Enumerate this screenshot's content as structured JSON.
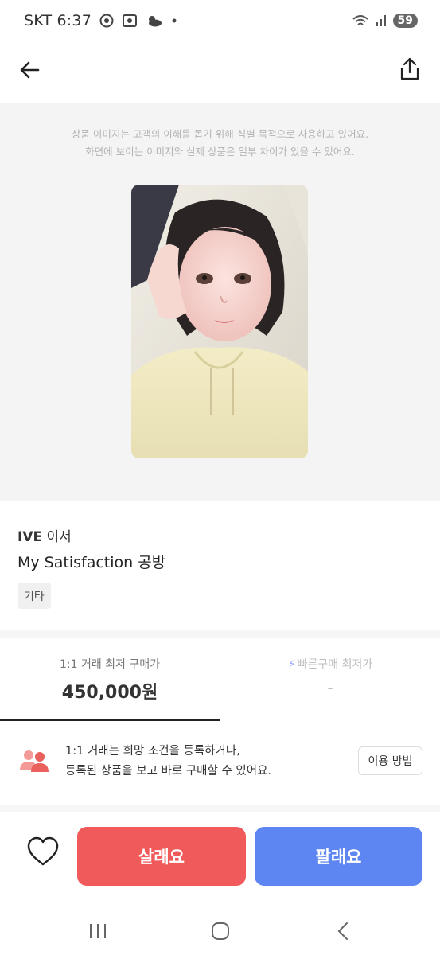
{
  "status_bar": {
    "carrier": "SKT",
    "time": "6:37",
    "battery": "59",
    "icons": [
      "chrome-icon",
      "screenshot-icon",
      "weather-icon",
      "dot-icon",
      "wifi-icon",
      "signal-icon",
      "battery-icon"
    ]
  },
  "top_bar": {
    "icons": [
      "back-arrow-icon",
      "share-icon"
    ]
  },
  "image_section": {
    "notice_line1": "상품 이미지는 고객의 이해를 돕기 위해 식별 목적으로 사용하고 있어요.",
    "notice_line2": "화면에 보이는 이미지와 실제 상품은 일부 차이가 있을 수 있어요."
  },
  "product": {
    "brand": "IVE",
    "member": "이서",
    "title": "My Satisfaction 공방",
    "tag": "기타"
  },
  "price_tabs": {
    "left_label": "1:1 거래 최저 구매가",
    "left_value": "450,000원",
    "right_label": "빠른구매 최저가",
    "right_value": "-"
  },
  "info_banner": {
    "line1": "1:1 거래는 희망 조건을 등록하거나,",
    "line2": "등록된 상품을 보고 바로 구매할 수 있어요.",
    "button": "이용 방법"
  },
  "actions": {
    "buy": "살래요",
    "sell": "팔래요"
  },
  "colors": {
    "buy": "#f05a5a",
    "sell": "#5d86f2",
    "page_bg_gray": "#f4f4f4"
  },
  "nav_bar": {
    "icons": [
      "recent-apps-icon",
      "home-icon",
      "back-icon"
    ]
  }
}
